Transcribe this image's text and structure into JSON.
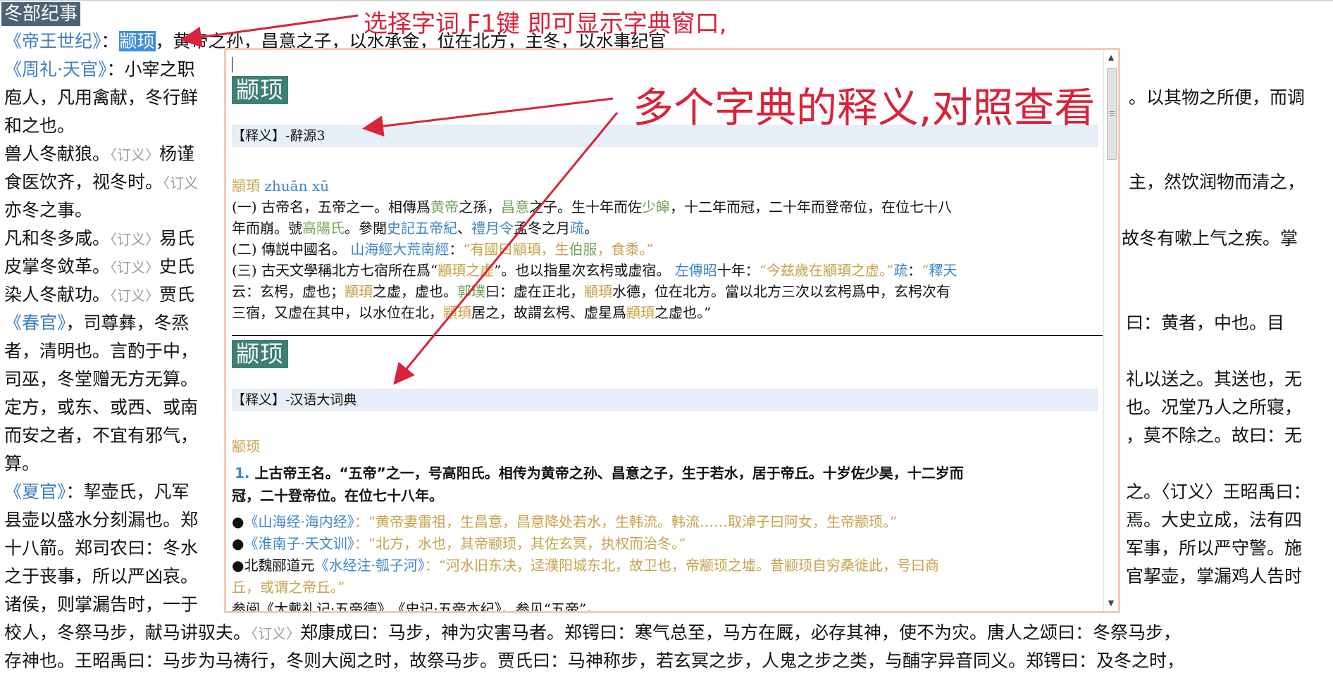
{
  "background": {
    "title": "冬部纪事",
    "lines": [
      {
        "left_link": "《帝王世纪》",
        "colon": "：",
        "selected": "颛顼",
        "rest": "，黄帝之孙，昌意之子，以水承金，位在北方，主冬，以水事纪官"
      },
      {
        "left_link": "《周礼·天官》",
        "rest": "：小宰之职"
      },
      {
        "rest": "庖人，凡用禽献，冬行鲜"
      },
      {
        "rest": "和之也。"
      },
      {
        "rest": "兽人冬献狼。",
        "note": "〈订义〉",
        "rest2": "杨谨"
      },
      {
        "rest": "食医饮齐，视冬时。",
        "note": "〈订义"
      },
      {
        "rest": "亦冬之事。"
      },
      {
        "rest": "凡和冬多咸。",
        "note": "〈订义〉",
        "rest2": "易氏"
      },
      {
        "rest": "皮掌冬敛革。",
        "note": "〈订义〉",
        "rest2": "史氏"
      },
      {
        "rest": "染人冬献功。",
        "note": "〈订义〉",
        "rest2": "贾氏"
      },
      {
        "left_link": "《春官》",
        "rest": "，司尊彝，冬烝"
      },
      {
        "rest": "者，清明也。言酌于中，"
      },
      {
        "rest": "司巫，冬堂赠无方无算。"
      },
      {
        "rest": "定方，或东、或西、或南"
      },
      {
        "rest": "而安之者，不宜有邪气，"
      },
      {
        "rest": "算。"
      },
      {
        "left_link": "《夏官》",
        "rest": "：挈壶氏，凡军"
      },
      {
        "rest": "县壶以盛水分刻漏也。郑"
      },
      {
        "rest": "十八箭。郑司农曰：冬水"
      },
      {
        "rest": "之于丧事，所以严凶哀。"
      },
      {
        "rest": "诸侯，则掌漏告时，一于"
      },
      {
        "rest": "校人，冬祭马步，献马讲驭夫。",
        "note": "〈订义〉",
        "rest2": "郑康成曰：马步，神为灾害马者。郑锷曰：寒气总至，马方在厩，必存其神，使不为灾。唐人之颂曰：冬祭马步，"
      },
      {
        "rest": "存神也。王昭禹曰：马步为马祷行，冬则大阅之时，故祭马步。贾氏曰：马神称步，若玄冥之步，人鬼之步之类，与酺字异音同义。郑锷曰：及冬之时，"
      }
    ],
    "right_fragments": [
      "。以其物之所便，而调",
      "主，然饮润物而清之，",
      "故冬有嗽上气之疾。掌",
      "曰：黄者，中也。目",
      "礼以送之。其送也，无",
      "也。况堂乃人之所寝，",
      "，莫不除之。故曰：无",
      "之。〈订义〉王昭禹曰：",
      "焉。大史立成，法有四",
      "军事，所以严守警。施",
      "官挈壶，掌漏鸡人告时"
    ]
  },
  "popup": {
    "entry1": {
      "headword": "颛顼",
      "source_label": "【释义】",
      "source_name": "-辭源3",
      "word": "顓頊",
      "pinyin": "zhuān xū",
      "senses": [
        "(一) 古帝名，五帝之一。相傳爲黄帝之孫，昌意之子。生十年而佐少皞，十二年而冠，二十年而登帝位，在位七十八",
        "年而崩。號高陽氏。參閲史記五帝紀、禮月令孟冬之月疏。",
        "(二) 傳説中國名。 山海經大荒南經：“有國曰顓頊，生伯服，食黍。”",
        "(三) 古天文學稱北方七宿所在爲“顓頊之虚”。也以指星次玄枵或虚宿。 左傳昭十年：“今兹歲在顓頊之虚。”疏：“釋天",
        "云：玄枵，虚也；顓頊之虚，虚也。郭璞曰：虚在正北，顓頊水德，位在北方。當以北方三次以玄枵爲中，玄枵次有",
        "三宿，又虚在其中，以水位在北，顓頊居之，故謂玄枵、虚星爲顓頊之虚也。”"
      ]
    },
    "entry2": {
      "headword": "颛顼",
      "source_label": "【释义】",
      "source_name": "-汉语大词典",
      "word": "颛顼",
      "sense1_num": "1.",
      "sense1_a": "上古帝王名。“五帝”之一，号高阳氏。相传为黄帝之孙、昌意之子，生于若水，居于帝丘。十岁佐少昊，十二岁而",
      "sense1_b": "冠，二十登帝位。在位七十八年。",
      "cites": [
        {
          "bullet": "●",
          "pre": "",
          "book": "《山海经·海内经》",
          "quote": "：“黄帝妻雷祖，生昌意，昌意降处若水，生韩流。韩流……取淖子曰阿女，生帝颛顼。”"
        },
        {
          "bullet": "●",
          "pre": "",
          "book": "《淮南子·天文训》",
          "quote": "：“北方，水也，其帝颛顼，其佐玄冥，执权而治冬。”"
        },
        {
          "bullet": "●",
          "pre": "北魏郦道元",
          "book": "《水经注·瓠子河》",
          "quote": "：“河水旧东决，迳濮阳城东北，故卫也，帝颛顼之墟。昔颛顼自穷桑徙此，号曰商"
        },
        {
          "bullet": "",
          "pre": "",
          "book": "",
          "quote": "丘，或谓之帝丘。”"
        }
      ],
      "cutoff": "参阅《大戴礼记·五帝德》、《史记·五帝本纪》。参见“五帝”。"
    }
  },
  "annotations": {
    "top": "选择字词,F1键 即可显示字典窗口,",
    "middle": "多个字典的释义,对照查看",
    "color": "#d8233a"
  }
}
